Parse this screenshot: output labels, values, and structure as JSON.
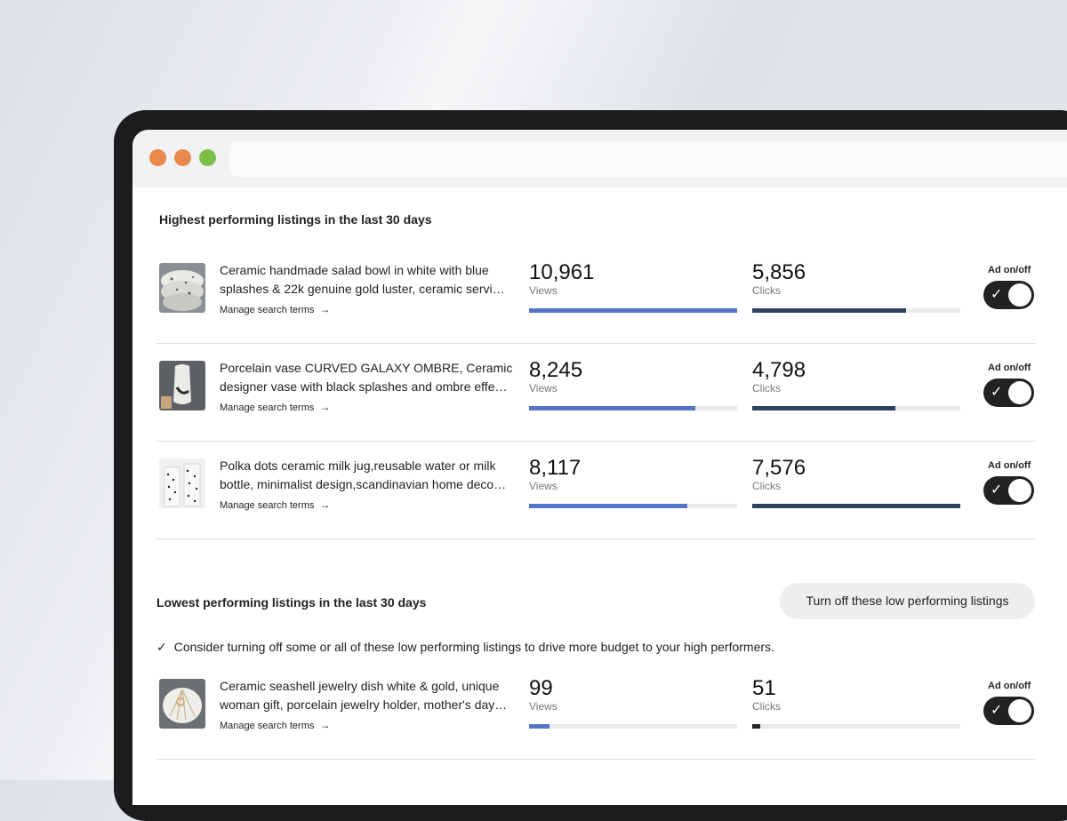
{
  "highest": {
    "title": "Highest performing listings in the last 30 days",
    "listings": [
      {
        "title_line1": "Ceramic handmade salad bowl in white with blue",
        "title_line2": "splashes & 22k genuine gold luster, ceramic servi…",
        "manage": "Manage search terms",
        "views": "10,961",
        "views_label": "Views",
        "views_fill": 1.0,
        "clicks": "5,856",
        "clicks_label": "Clicks",
        "clicks_fill": 0.74,
        "ad_label": "Ad on/off",
        "ad_on": true
      },
      {
        "title_line1": "Porcelain vase CURVED GALAXY OMBRE, Ceramic",
        "title_line2": "designer vase with black splashes and ombre effe…",
        "manage": "Manage search terms",
        "views": "8,245",
        "views_label": "Views",
        "views_fill": 0.8,
        "clicks": "4,798",
        "clicks_label": "Clicks",
        "clicks_fill": 0.69,
        "ad_label": "Ad on/off",
        "ad_on": true
      },
      {
        "title_line1": "Polka dots ceramic milk jug,reusable water or milk",
        "title_line2": "bottle, minimalist design,scandinavian home deco…",
        "manage": "Manage search terms",
        "views": "8,117",
        "views_label": "Views",
        "views_fill": 0.76,
        "clicks": "7,576",
        "clicks_label": "Clicks",
        "clicks_fill": 1.0,
        "ad_label": "Ad on/off",
        "ad_on": true
      }
    ]
  },
  "lowest": {
    "title": "Lowest performing listings in the last 30 days",
    "turn_off_button": "Turn off these low performing listings",
    "hint_icon": "check-icon",
    "hint": "Consider turning off some or all of these low performing listings to drive more budget to your high performers.",
    "listings": [
      {
        "title_line1": "Ceramic seashell jewelry dish white & gold, unique",
        "title_line2": "woman gift, porcelain jewelry holder, mother's day…",
        "manage": "Manage search terms",
        "views": "99",
        "views_label": "Views",
        "views_fill": 0.1,
        "clicks": "51",
        "clicks_label": "Clicks",
        "clicks_fill": 0.04,
        "ad_label": "Ad on/off",
        "ad_on": true
      }
    ]
  },
  "colors": {
    "views_bar": "#5574c9",
    "clicks_bar": "#2e4263",
    "toggle_on": "#222222",
    "close_dot": "#e8884a",
    "min_dot": "#e8884a",
    "max_dot": "#7cc04a"
  }
}
